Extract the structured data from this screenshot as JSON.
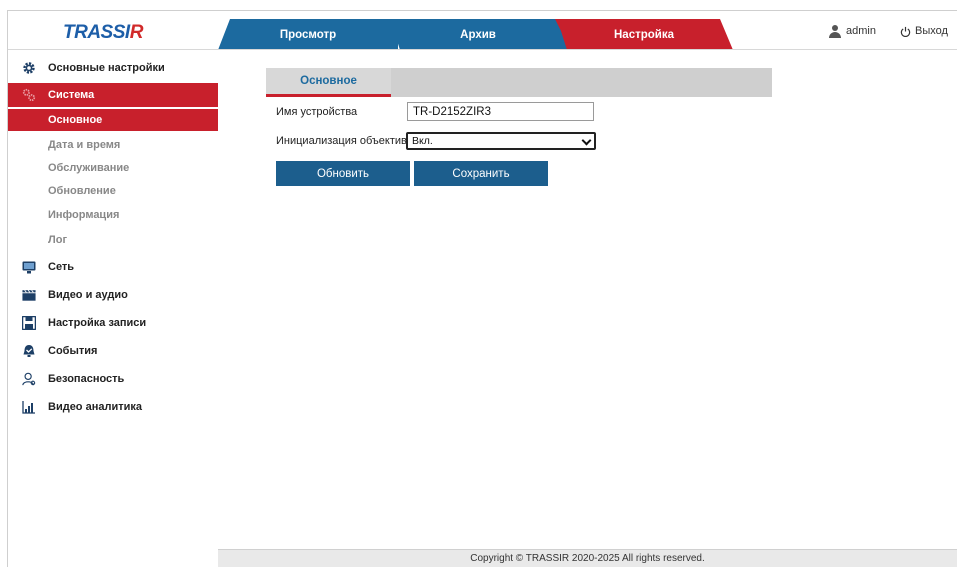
{
  "header": {
    "logo_main": "TRASSI",
    "logo_accent": "R",
    "tabs": [
      {
        "label": "Просмотр"
      },
      {
        "label": "Архив"
      },
      {
        "label": "Настройка"
      }
    ],
    "user": "admin",
    "logout": "Выход"
  },
  "sidebar": {
    "items": [
      {
        "label": "Основные настройки",
        "icon": "gear-icon"
      },
      {
        "label": "Система",
        "icon": "system-gears-icon"
      },
      {
        "label": "Сеть",
        "icon": "network-icon"
      },
      {
        "label": "Видео и аудио",
        "icon": "clapperboard-icon"
      },
      {
        "label": "Настройка записи",
        "icon": "floppy-icon"
      },
      {
        "label": "События",
        "icon": "events-icon"
      },
      {
        "label": "Безопасность",
        "icon": "user-security-icon"
      },
      {
        "label": "Видео аналитика",
        "icon": "analytics-icon"
      }
    ],
    "sub_items": [
      {
        "label": "Основное"
      },
      {
        "label": "Дата и время"
      },
      {
        "label": "Обслуживание"
      },
      {
        "label": "Обновление"
      },
      {
        "label": "Информация"
      },
      {
        "label": "Лог"
      }
    ]
  },
  "main": {
    "section_tab": "Основное",
    "device_name_label": "Имя устройства",
    "device_name_value": "TR-D2152ZIR3",
    "lens_init_label": "Инициализация объектива",
    "lens_init_value": "Вкл.",
    "refresh_button": "Обновить",
    "save_button": "Сохранить"
  },
  "footer": {
    "copyright": "Copyright © TRASSIR 2020-2025 All rights reserved."
  },
  "colors": {
    "accent_red": "#c8202c",
    "tab_blue": "#1c6a9f",
    "button_blue": "#1c5e8d"
  }
}
